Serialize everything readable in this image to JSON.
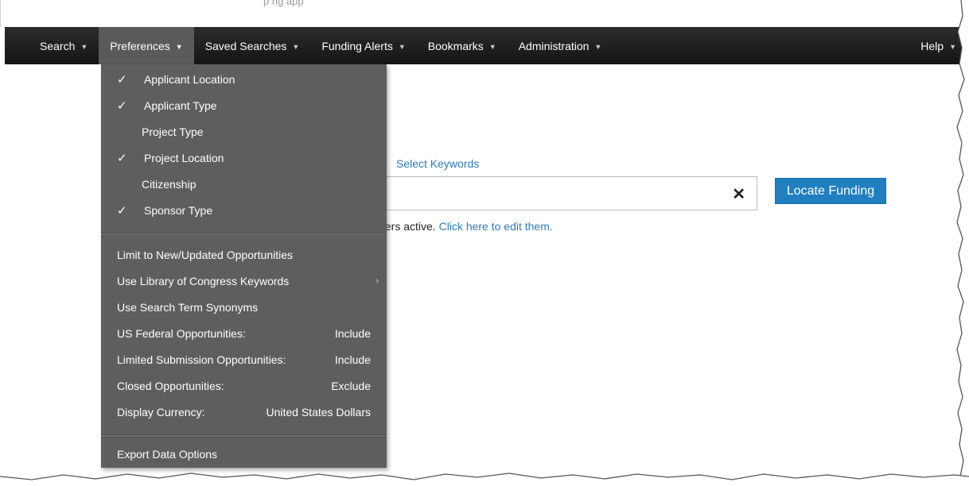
{
  "top_strip": {
    "partial_text": "p                                ng app"
  },
  "nav": {
    "items": [
      {
        "label": "Search",
        "active": false
      },
      {
        "label": "Preferences",
        "active": true
      },
      {
        "label": "Saved Searches",
        "active": false
      },
      {
        "label": "Funding Alerts",
        "active": false
      },
      {
        "label": "Bookmarks",
        "active": false
      },
      {
        "label": "Administration",
        "active": false
      }
    ],
    "help_label": "Help",
    "caret_icon": "chevron-down-icon"
  },
  "main": {
    "select_keywords": "Select Keywords",
    "search_value": "",
    "clear_glyph": "✕",
    "locate_button": "Locate Funding",
    "filters_prefix": "ters active.",
    "filters_link": "Click here to edit them."
  },
  "dropdown": {
    "filters": [
      {
        "label": "Applicant Location",
        "checked": true
      },
      {
        "label": "Applicant Type",
        "checked": true
      },
      {
        "label": "Project Type",
        "checked": false
      },
      {
        "label": "Project Location",
        "checked": true
      },
      {
        "label": "Citizenship",
        "checked": false
      },
      {
        "label": "Sponsor Type",
        "checked": true
      }
    ],
    "options": [
      {
        "label": "Limit to New/Updated Opportunities",
        "value": ""
      },
      {
        "label": "Use Library of Congress Keywords",
        "value": "",
        "submenu": true
      },
      {
        "label": "Use Search Term Synonyms",
        "value": ""
      },
      {
        "label": "US Federal Opportunities:",
        "value": "Include"
      },
      {
        "label": "Limited Submission Opportunities:",
        "value": "Include"
      },
      {
        "label": "Closed Opportunities:",
        "value": "Exclude"
      },
      {
        "label": "Display Currency:",
        "value": "United States Dollars"
      }
    ],
    "export": "Export Data Options",
    "check_glyph": "✓",
    "submenu_glyph": "›"
  },
  "colors": {
    "navbar": "#1c1c1c",
    "dropdown_bg": "#5e5e5e",
    "link": "#2b7bbf",
    "button": "#1f7fc0"
  }
}
